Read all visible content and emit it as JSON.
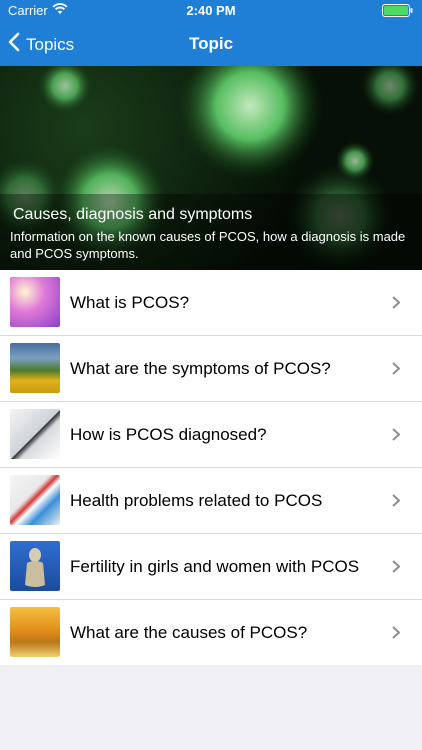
{
  "status_bar": {
    "carrier": "Carrier",
    "time": "2:40 PM",
    "wifi_icon": "wifi-icon",
    "battery_icon": "battery-icon"
  },
  "nav": {
    "back_label": "Topics",
    "title": "Topic",
    "back_icon": "chevron-left-icon"
  },
  "hero": {
    "title": "Causes, diagnosis and symptoms",
    "subtitle": "Information on the known causes of PCOS, how a diagnosis is made and PCOS symptoms."
  },
  "items": [
    {
      "label": "What is PCOS?"
    },
    {
      "label": "What are the symptoms of PCOS?"
    },
    {
      "label": "How is PCOS diagnosed?"
    },
    {
      "label": "Health problems related to PCOS"
    },
    {
      "label": "Fertility in girls and women with PCOS"
    },
    {
      "label": "What are the causes of PCOS?"
    }
  ],
  "colors": {
    "accent": "#1f7fd6",
    "background": "#efeff4"
  }
}
